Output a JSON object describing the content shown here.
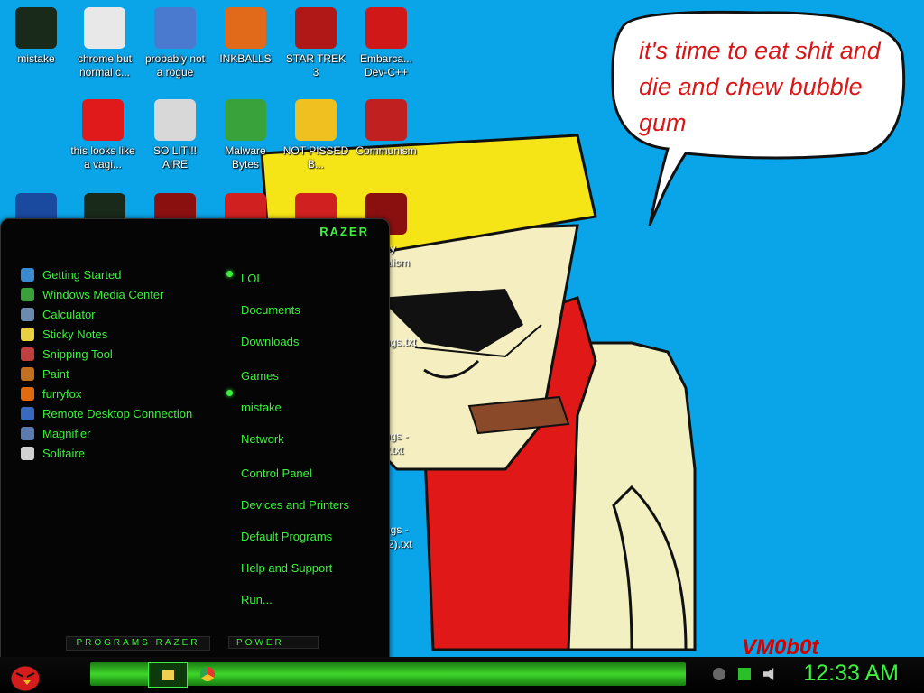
{
  "desktop_icons": [
    {
      "label": "mistake",
      "icon": "razer-game-icon",
      "color": "#1a2a1a"
    },
    {
      "label": "chrome but normal c...",
      "icon": "chrome-icon",
      "color": "#e8e8e8"
    },
    {
      "label": "probably not a rogue",
      "icon": "computer-settings-icon",
      "color": "#4a7ad0"
    },
    {
      "label": "INKBALLS",
      "icon": "ink-ball-icon",
      "color": "#e06a1a"
    },
    {
      "label": "STAR TREK 3",
      "icon": "star-wars-icon",
      "color": "#b01818"
    },
    {
      "label": "Embarca... Dev-C++",
      "icon": "devcpp-icon",
      "color": "#d01818"
    },
    {
      "label": "this looks like a vagi...",
      "icon": "opera-icon",
      "color": "#e01a1a"
    },
    {
      "label": "SO LIT!!! AIRE",
      "icon": "solitaire-card-icon",
      "color": "#d8d8d8"
    },
    {
      "label": "Malware Bytes",
      "icon": "shield-icon",
      "color": "#3aa23a"
    },
    {
      "label": "NOT PISSED B...",
      "icon": "angry-pig-icon",
      "color": "#f0c020"
    },
    {
      "label": "Communism",
      "icon": "communism-logo-icon",
      "color": "#c02020"
    },
    {
      "label": "",
      "icon": "photoshop-icon",
      "color": "#1a4aa0"
    },
    {
      "label": "",
      "icon": "razer-game-icon",
      "color": "#1a2a1a"
    },
    {
      "label": "",
      "icon": "flash-icon",
      "color": "#8a1010"
    },
    {
      "label": "",
      "icon": "angry-bird-icon",
      "color": "#d02020"
    },
    {
      "label": "",
      "icon": "angry-bird-icon",
      "color": "#d02020"
    },
    {
      "label": "",
      "icon": "flash-icon",
      "color": "#8a1010"
    }
  ],
  "desktop_fragments": [
    "ay",
    "alism",
    "ngs.txt",
    "ngs -",
    "y.txt",
    "ngs -",
    "(2).txt"
  ],
  "speech_bubble": "it's time to eat shit and die and chew bubble gum",
  "signature": "VM0b0t",
  "start_menu": {
    "brand": "RAZER",
    "programs": [
      {
        "label": "Getting Started",
        "has_submenu": true
      },
      {
        "label": "Windows Media Center",
        "has_submenu": false
      },
      {
        "label": "Calculator",
        "has_submenu": false
      },
      {
        "label": "Sticky Notes",
        "has_submenu": false
      },
      {
        "label": "Snipping Tool",
        "has_submenu": false
      },
      {
        "label": "Paint",
        "has_submenu": false
      },
      {
        "label": "furryfox",
        "has_submenu": true
      },
      {
        "label": "Remote Desktop Connection",
        "has_submenu": false
      },
      {
        "label": "Magnifier",
        "has_submenu": false
      },
      {
        "label": "Solitaire",
        "has_submenu": false
      }
    ],
    "places": [
      "LOL",
      "Documents",
      "Downloads",
      "Games",
      "mistake",
      "Network",
      "Control Panel",
      "Devices and Printers",
      "Default Programs",
      "Help and Support",
      "Run..."
    ],
    "programs_bar": "PROGRAMS RAZER",
    "power_label": "POWER"
  },
  "taskbar": {
    "clock": "12:33 AM"
  },
  "accent": "#3df03d"
}
